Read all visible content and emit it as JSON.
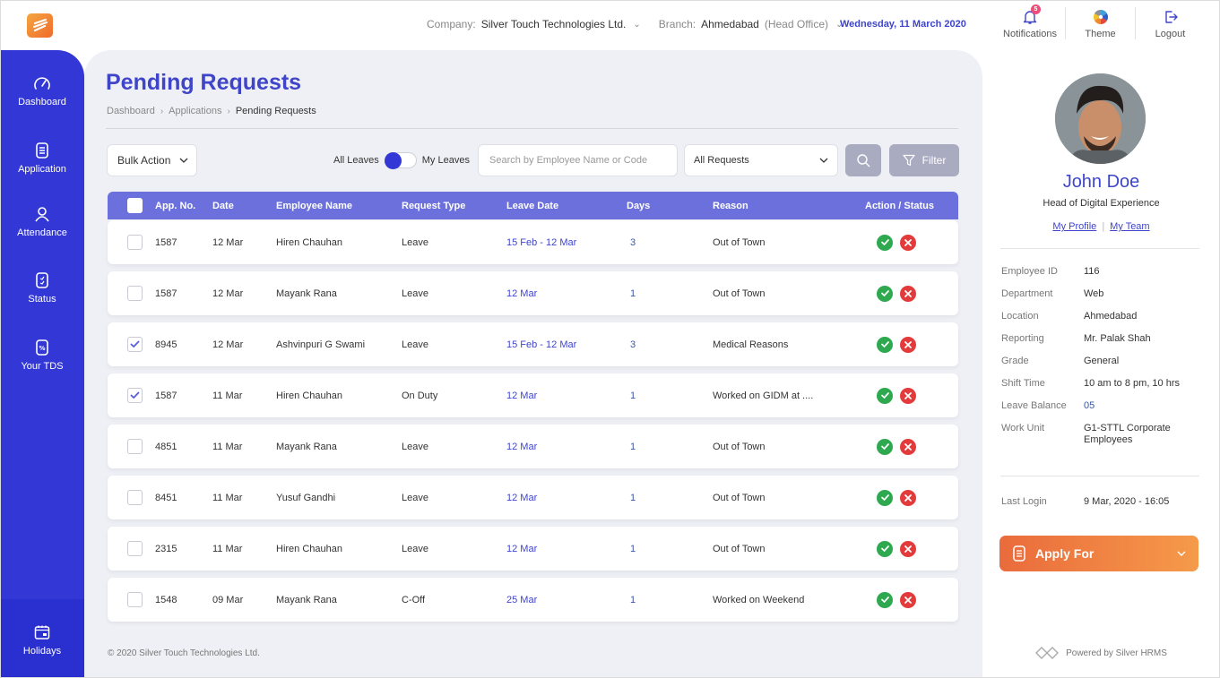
{
  "header": {
    "company_label": "Company:",
    "company_value": "Silver Touch Technologies Ltd.",
    "branch_label": "Branch:",
    "branch_value": "Ahmedabad",
    "branch_note": "(Head Office)",
    "date": "Wednesday, 11 March 2020",
    "notifications_label": "Notifications",
    "notifications_count": "5",
    "theme_label": "Theme",
    "logout_label": "Logout",
    "logo_icon": "logo-icon"
  },
  "sidebar": {
    "items": [
      {
        "label": "Dashboard",
        "icon": "speedometer-icon"
      },
      {
        "label": "Application",
        "icon": "document-icon"
      },
      {
        "label": "Attendance",
        "icon": "user-icon"
      },
      {
        "label": "Status",
        "icon": "checklist-icon"
      },
      {
        "label": "Your TDS",
        "icon": "percent-icon"
      }
    ],
    "bottom": {
      "label": "Holidays",
      "icon": "calendar-icon"
    }
  },
  "page": {
    "title": "Pending Requests",
    "breadcrumb": [
      "Dashboard",
      "Applications",
      "Pending Requests"
    ]
  },
  "toolbar": {
    "bulk_action": "Bulk Action",
    "toggle_left": "All Leaves",
    "toggle_right": "My Leaves",
    "search_placeholder": "Search by Employee Name or Code",
    "search_value": "",
    "request_filter": "All Requests",
    "filter_label": "Filter"
  },
  "table": {
    "columns": [
      "App. No.",
      "Date",
      "Employee Name",
      "Request Type",
      "Leave Date",
      "Days",
      "Reason",
      "Action / Status"
    ],
    "rows": [
      {
        "checked": false,
        "app_no": "1587",
        "date": "12 Mar",
        "name": "Hiren Chauhan",
        "type": "Leave",
        "leave_date": "15 Feb - 12 Mar",
        "days": "3",
        "reason": "Out of Town"
      },
      {
        "checked": false,
        "app_no": "1587",
        "date": "12 Mar",
        "name": "Mayank Rana",
        "type": "Leave",
        "leave_date": "12 Mar",
        "days": "1",
        "reason": "Out of Town"
      },
      {
        "checked": true,
        "app_no": "8945",
        "date": "12 Mar",
        "name": "Ashvinpuri G Swami",
        "type": "Leave",
        "leave_date": "15 Feb - 12 Mar",
        "days": "3",
        "reason": "Medical Reasons"
      },
      {
        "checked": true,
        "app_no": "1587",
        "date": "11 Mar",
        "name": "Hiren Chauhan",
        "type": "On Duty",
        "leave_date": "12 Mar",
        "days": "1",
        "reason": "Worked on GIDM at ...."
      },
      {
        "checked": false,
        "app_no": "4851",
        "date": "11 Mar",
        "name": "Mayank Rana",
        "type": "Leave",
        "leave_date": "12 Mar",
        "days": "1",
        "reason": "Out of Town"
      },
      {
        "checked": false,
        "app_no": "8451",
        "date": "11 Mar",
        "name": "Yusuf Gandhi",
        "type": "Leave",
        "leave_date": "12 Mar",
        "days": "1",
        "reason": "Out of Town"
      },
      {
        "checked": false,
        "app_no": "2315",
        "date": "11 Mar",
        "name": "Hiren Chauhan",
        "type": "Leave",
        "leave_date": "12 Mar",
        "days": "1",
        "reason": "Out of Town"
      },
      {
        "checked": false,
        "app_no": "1548",
        "date": "09 Mar",
        "name": "Mayank Rana",
        "type": "C-Off",
        "leave_date": "25 Mar",
        "days": "1",
        "reason": "Worked on Weekend"
      }
    ]
  },
  "footer": {
    "copyright": "© 2020 Silver Touch Technologies Ltd."
  },
  "profile": {
    "name": "John Doe",
    "role": "Head of Digital Experience",
    "link_profile": "My Profile",
    "link_team": "My Team",
    "separator": "|",
    "details": [
      {
        "label": "Employee ID",
        "value": "116"
      },
      {
        "label": "Department",
        "value": "Web"
      },
      {
        "label": "Location",
        "value": "Ahmedabad"
      },
      {
        "label": "Reporting",
        "value": "Mr. Palak Shah"
      },
      {
        "label": "Grade",
        "value": "General"
      },
      {
        "label": "Shift Time",
        "value": "10 am to 8 pm, 10 hrs"
      },
      {
        "label": "Leave Balance",
        "value": "05"
      },
      {
        "label": "Work Unit",
        "value": "G1-STTL Corporate Employees"
      }
    ],
    "last_login_label": "Last Login",
    "last_login_value": "9 Mar, 2020 - 16:05",
    "apply_label": "Apply For",
    "powered_by": "Powered by Silver HRMS"
  },
  "colors": {
    "brand_blue": "#3237d6",
    "accent_blue": "#3f45c9",
    "table_header": "#6b70dc",
    "approve": "#2ea94f",
    "reject": "#e33b3b",
    "apply_gradient_start": "#ea6b3c",
    "apply_gradient_end": "#f59a4a"
  }
}
